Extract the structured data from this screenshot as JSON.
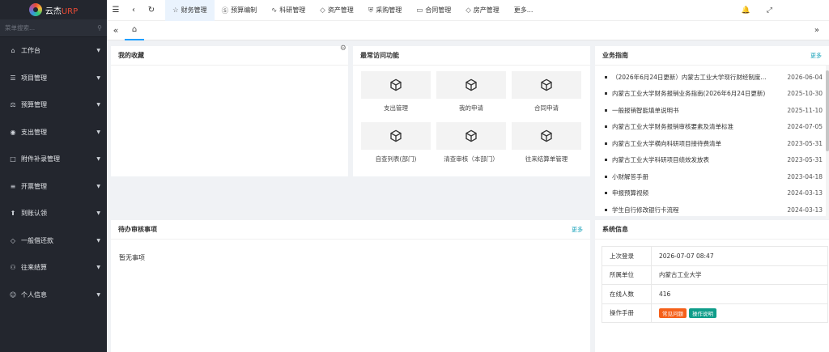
{
  "app": {
    "logo_text": "云杰",
    "logo_accent": "URP"
  },
  "sidebar": {
    "search_placeholder": "菜单搜索...",
    "items": [
      {
        "label": "工作台",
        "icon": "home-icon"
      },
      {
        "label": "项目管理",
        "icon": "list-icon"
      },
      {
        "label": "预算管理",
        "icon": "scale-icon"
      },
      {
        "label": "支出管理",
        "icon": "circle-icon"
      },
      {
        "label": "附件补录管理",
        "icon": "folder-icon"
      },
      {
        "label": "开票管理",
        "icon": "invoice-icon"
      },
      {
        "label": "到账认领",
        "icon": "upload-icon"
      },
      {
        "label": "一般借还款",
        "icon": "diamond-icon"
      },
      {
        "label": "往来结算",
        "icon": "users-icon"
      },
      {
        "label": "个人信息",
        "icon": "user-icon"
      }
    ]
  },
  "topbar": {
    "tabs": [
      {
        "label": "财务管理",
        "icon": "star-icon",
        "active": true
      },
      {
        "label": "预算编制",
        "icon": "dollar-icon"
      },
      {
        "label": "科研管理",
        "icon": "pulse-icon"
      },
      {
        "label": "资产管理",
        "icon": "diamond-icon"
      },
      {
        "label": "采购管理",
        "icon": "shield-icon"
      },
      {
        "label": "合同管理",
        "icon": "car-icon"
      },
      {
        "label": "房产管理",
        "icon": "diamond-icon"
      }
    ],
    "more_label": "更多..."
  },
  "favorites": {
    "title": "我的收藏"
  },
  "quick": {
    "title": "最常访问功能",
    "items": [
      "支出管理",
      "我的申请",
      "合同申请",
      "自查列表(部门)",
      "清查审核（本部门）",
      "往来结算单管理"
    ]
  },
  "guide": {
    "title": "业务指南",
    "more": "更多",
    "items": [
      {
        "title": "（2026年6月24日更新）内蒙古工业大学现行财经制度...",
        "date": "2026-06-04"
      },
      {
        "title": "内蒙古工业大学财务报销业务指南(2026年6月24日更新)",
        "date": "2025-10-30"
      },
      {
        "title": "一般报销智能填单说明书",
        "date": "2025-11-10"
      },
      {
        "title": "内蒙古工业大学财务报销审核要素及清单标准",
        "date": "2024-07-05"
      },
      {
        "title": "内蒙古工业大学横向科研项目接待费清单",
        "date": "2023-05-31"
      },
      {
        "title": "内蒙古工业大学科研项目绩效发放表",
        "date": "2023-05-31"
      },
      {
        "title": "小财解答手册",
        "date": "2023-04-18"
      },
      {
        "title": "申报预算视频",
        "date": "2024-03-13"
      },
      {
        "title": "学生自行修改银行卡流程",
        "date": "2024-03-13"
      }
    ]
  },
  "pending": {
    "title": "待办审核事项",
    "more": "更多",
    "empty": "暂无事项"
  },
  "sysinfo": {
    "title": "系统信息",
    "rows": [
      {
        "key": "上次登录",
        "value": "2026-07-07 08:47"
      },
      {
        "key": "所属单位",
        "value": "内蒙古工业大学"
      },
      {
        "key": "在线人数",
        "value": "416"
      }
    ],
    "manual_key": "操作手册",
    "badge_faq": "常见问题",
    "badge_guide": "操作说明"
  }
}
